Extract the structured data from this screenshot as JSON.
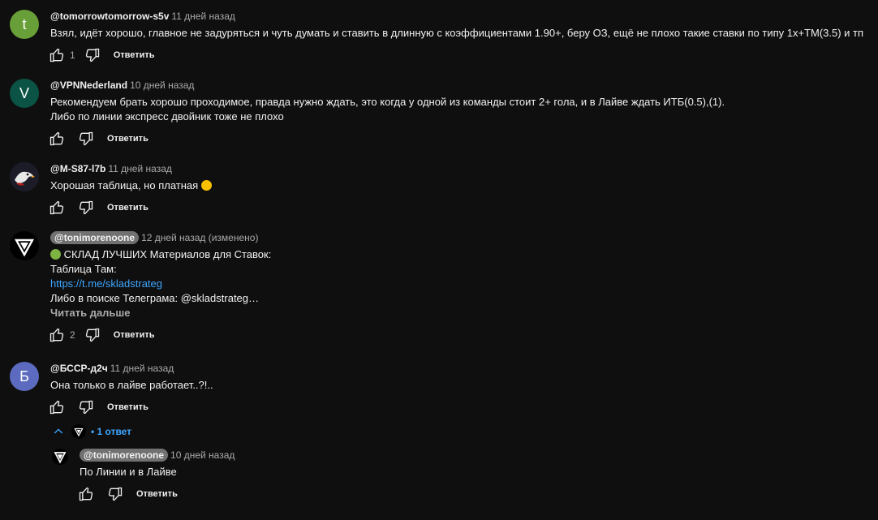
{
  "comments": [
    {
      "avatar_letter": "t",
      "author": "@tomorrowtomorrow-s5v",
      "time": "11 дней назад",
      "lines": [
        "Взял, идёт хорошо, главное не задуряться и чуть думать и ставить в длинную с коэффициентами 1.90+, беру  ОЗ, ещё не плохо такие ставки по типу 1х+ТМ(3.5) и тп"
      ],
      "likes": "1",
      "reply_label": "Ответить"
    },
    {
      "avatar_letter": "V",
      "author": "@VPNNederland",
      "time": "10 дней назад",
      "lines": [
        "Рекомендуем брать хорошо проходимое, правда нужно ждать, это когда у одной из команды стоит 2+ гола, и в Лайве ждать ИТБ(0.5),(1).",
        "Либо по линии экспресс двойник тоже не плохо"
      ],
      "likes": "",
      "reply_label": "Ответить"
    },
    {
      "avatar_letter": "",
      "author": "@M-S87-l7b",
      "time": "11 дней назад",
      "lines": [
        "Хорошая таблица, но платная"
      ],
      "likes": "",
      "reply_label": "Ответить"
    },
    {
      "avatar_letter": "",
      "author": "@tonimorenoone",
      "time": "12 дней назад (изменено)",
      "lines": [
        "СКЛАД ЛУЧШИХ Материалов для Ставок:",
        "Таблица Там:",
        "https://t.me/skladstrateg",
        "Либо в поиске Телеграма: @skladstrateg…"
      ],
      "read_more": "Читать дальше",
      "likes": "2",
      "reply_label": "Ответить"
    },
    {
      "avatar_letter": "Б",
      "author": "@БССР-д2ч",
      "time": "11 дней назад",
      "lines": [
        "Она только в лайве работает..?!.."
      ],
      "likes": "",
      "reply_label": "Ответить"
    }
  ],
  "replies_toggle": {
    "label": "• 1 ответ"
  },
  "reply": {
    "author": "@tonimorenoone",
    "time": "10 дней назад",
    "text": "По Линии и в Лайве",
    "reply_label": "Ответить"
  },
  "colors": {
    "avatar_t": "#689f38",
    "avatar_v": "#0b5345",
    "avatar_b": "#5c6bc0",
    "link": "#3ea6ff"
  }
}
